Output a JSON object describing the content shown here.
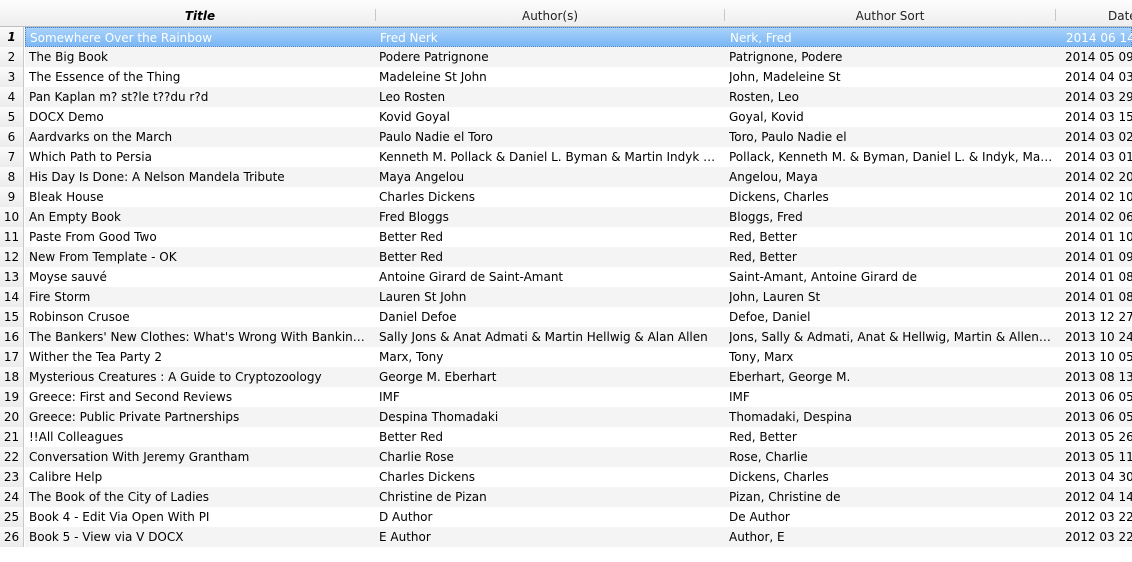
{
  "columns": {
    "title": "Title",
    "authors": "Author(s)",
    "author_sort": "Author Sort",
    "date": "Date"
  },
  "colors": {
    "selected_row": "#8ec4f8",
    "alt_row": "#f4f4f4"
  },
  "books": [
    {
      "n": "1",
      "title": "Somewhere Over the Rainbow",
      "authors": "Fred Nerk",
      "sort": "Nerk, Fred",
      "date": "2014 06 14"
    },
    {
      "n": "2",
      "title": "The Big Book",
      "authors": "Podere Patrignone",
      "sort": "Patrignone, Podere",
      "date": "2014 05 09"
    },
    {
      "n": "3",
      "title": "The Essence of the Thing",
      "authors": "Madeleine St John",
      "sort": "John, Madeleine St",
      "date": "2014 04 03"
    },
    {
      "n": "4",
      "title": "Pan Kaplan m? st?le t??du r?d",
      "authors": "Leo Rosten",
      "sort": "Rosten, Leo",
      "date": "2014 03 29"
    },
    {
      "n": "5",
      "title": "DOCX Demo",
      "authors": "Kovid Goyal",
      "sort": "Goyal, Kovid",
      "date": "2014 03 15"
    },
    {
      "n": "6",
      "title": "Aardvarks on the March",
      "authors": "Paulo Nadie el Toro",
      "sort": "Toro, Paulo Nadie el",
      "date": "2014 03 02"
    },
    {
      "n": "7",
      "title": "Which Path to Persia",
      "authors": "Kenneth M. Pollack & Daniel L. Byman & Martin Indyk & Suza...",
      "sort": "Pollack, Kenneth M. & Byman, Daniel L. & Indyk, Martin &...",
      "date": "2014 03 01"
    },
    {
      "n": "8",
      "title": "His Day Is Done: A Nelson Mandela Tribute",
      "authors": "Maya Angelou",
      "sort": "Angelou, Maya",
      "date": "2014 02 20"
    },
    {
      "n": "9",
      "title": "Bleak House",
      "authors": "Charles Dickens",
      "sort": "Dickens, Charles",
      "date": "2014 02 10"
    },
    {
      "n": "10",
      "title": "An Empty Book",
      "authors": "Fred Bloggs",
      "sort": "Bloggs, Fred",
      "date": "2014 02 06"
    },
    {
      "n": "11",
      "title": "Paste From Good Two",
      "authors": "Better Red",
      "sort": "Red, Better",
      "date": "2014 01 10"
    },
    {
      "n": "12",
      "title": "New From Template - OK",
      "authors": "Better Red",
      "sort": "Red, Better",
      "date": "2014 01 09"
    },
    {
      "n": "13",
      "title": "Moyse sauvé",
      "authors": "Antoine Girard de Saint-Amant",
      "sort": "Saint-Amant, Antoine Girard de",
      "date": "2014 01 08"
    },
    {
      "n": "14",
      "title": "Fire Storm",
      "authors": "Lauren St John",
      "sort": "John, Lauren St",
      "date": "2014 01 08"
    },
    {
      "n": "15",
      "title": "Robinson Crusoe",
      "authors": "Daniel Defoe",
      "sort": "Defoe, Daniel",
      "date": "2013 12 27"
    },
    {
      "n": "16",
      "title": "The Bankers' New Clothes: What's Wrong With Banking and...",
      "authors": "Sally Jons & Anat Admati & Martin Hellwig & Alan Allen",
      "sort": "Jons, Sally & Admati, Anat & Hellwig, Martin & Allen, Alan",
      "date": "2013 10 24"
    },
    {
      "n": "17",
      "title": "Wither the Tea Party 2",
      "authors": "Marx, Tony",
      "sort": "Tony, Marx",
      "date": "2013 10 05"
    },
    {
      "n": "18",
      "title": "Mysterious Creatures : A Guide to Cryptozoology",
      "authors": "George M. Eberhart",
      "sort": "Eberhart, George M.",
      "date": "2013 08 13"
    },
    {
      "n": "19",
      "title": "Greece: First and Second Reviews",
      "authors": "IMF",
      "sort": "IMF",
      "date": "2013 06 05"
    },
    {
      "n": "20",
      "title": "Greece: Public Private Partnerships",
      "authors": "Despina Thomadaki",
      "sort": "Thomadaki, Despina",
      "date": "2013 06 05"
    },
    {
      "n": "21",
      "title": "!!All Colleagues",
      "authors": "Better Red",
      "sort": "Red, Better",
      "date": "2013 05 26"
    },
    {
      "n": "22",
      "title": "Conversation With Jeremy Grantham",
      "authors": "Charlie Rose",
      "sort": "Rose, Charlie",
      "date": "2013 05 11"
    },
    {
      "n": "23",
      "title": "Calibre Help",
      "authors": "Charles Dickens",
      "sort": "Dickens, Charles",
      "date": "2013 04 30"
    },
    {
      "n": "24",
      "title": "The Book of the City of Ladies",
      "authors": "Christine de Pizan",
      "sort": "Pizan, Christine de",
      "date": "2012 04 14"
    },
    {
      "n": "25",
      "title": "Book 4 - Edit Via Open With PI",
      "authors": "D Author",
      "sort": "De Author",
      "date": "2012 03 22"
    },
    {
      "n": "26",
      "title": "Book 5 - View via V DOCX",
      "authors": "E Author",
      "sort": "Author, E",
      "date": "2012 03 22"
    }
  ]
}
